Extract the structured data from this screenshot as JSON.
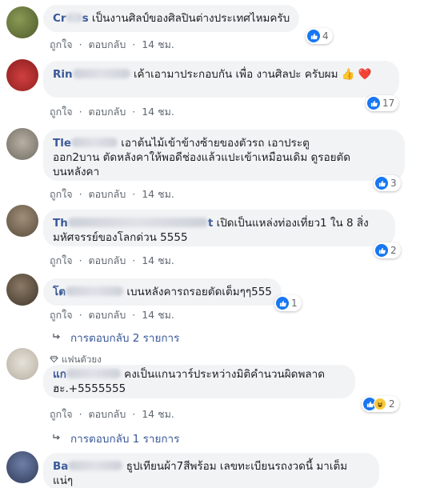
{
  "like_label": "ถูกใจ",
  "reply_label": "ตอบกลับ",
  "colors": {
    "link": "#385898",
    "bubble": "#f2f3f5",
    "like": "#1877f2",
    "meta": "#606770"
  },
  "comments": [
    {
      "author_visible": "Cr",
      "author_tail": "s",
      "text": "เป็นงานศิลป์ของศิลปินต่างประเทศไหมครับ",
      "time": "14 ชม.",
      "reactions": "4"
    },
    {
      "author_visible": "Rin",
      "text": "เค้าเอามาประกอบกัน เพื่อ งานศิลปะ ครับผม",
      "emoji": "👍 ❤️",
      "time": "14 ชม.",
      "reactions": "17"
    },
    {
      "author_visible": "Tle",
      "text_line1": "เอาต้นไม้เข้าข้างซ้ายของตัวรถ เอาประตู",
      "text_line2": "ออก2บาน ตัดหลังคาให้พอดีช่องแล้วแปะเข้าเหมือนเดิม ดูรอยตัด",
      "text_line3": "บนหลังคา",
      "time": "14 ชม.",
      "reactions": "3"
    },
    {
      "author_visible": "Th",
      "author_tail": "t",
      "text_line1": "เปิดเป็นแหล่งท่องเที่ยว1 ใน 8 สิ่ง",
      "text_line2": "มหัศจรรย์ของโลกด่วน 5555",
      "time": "14 ชม.",
      "reactions": "2"
    },
    {
      "author_visible": "โต",
      "text": "เบนหลังคารถรอยตัดเต็มๆๆ555",
      "time": "14 ชม.",
      "reactions": "1",
      "replies": "การตอบกลับ 2 รายการ"
    },
    {
      "badge": "แฟนตัวยง",
      "author_visible": "แก",
      "text_line1": "คงเป็นแกนวาร์ประหว่างมิติคำนวนผิดพลาด",
      "text_line2": "ฮะ.+5555555",
      "time": "14 ชม.",
      "reactions": "2",
      "replies": "การตอบกลับ 1 รายการ"
    },
    {
      "author_visible": "Ba",
      "text_line1": "ธูปเทียนผ้า7สีพร้อม เลขทะเบียนรถงวดนี้ มาเต็ม",
      "text_line2": "แน่ๆ"
    }
  ]
}
